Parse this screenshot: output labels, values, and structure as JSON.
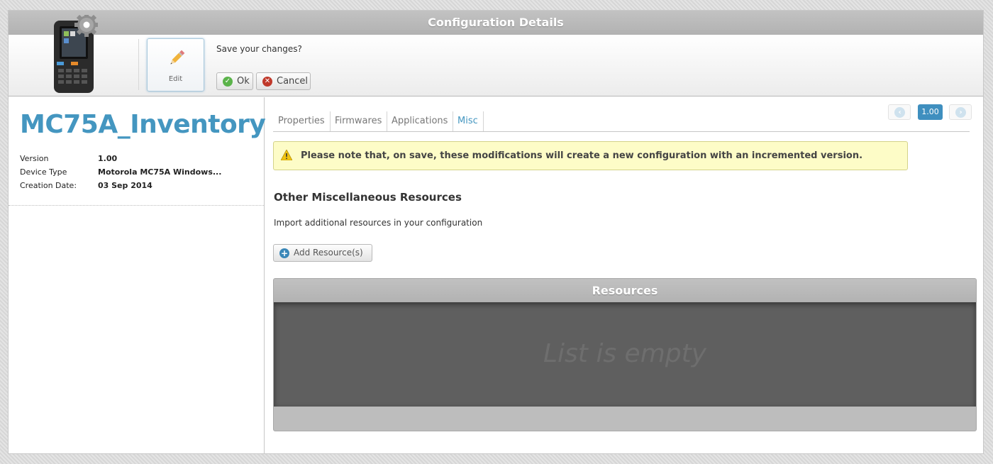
{
  "window": {
    "title": "Configuration Details"
  },
  "toolbar": {
    "edit_label": "Edit",
    "save_prompt": "Save your changes?",
    "ok_label": "Ok",
    "cancel_label": "Cancel"
  },
  "config": {
    "name": "MC75A_Inventory",
    "properties": [
      {
        "key": "Version",
        "value": "1.00"
      },
      {
        "key": "Device Type",
        "value": "Motorola MC75A Windows..."
      },
      {
        "key": "Creation Date:",
        "value": "03 Sep 2014"
      }
    ]
  },
  "tabs": [
    {
      "label": "Properties",
      "active": false
    },
    {
      "label": "Firmwares",
      "active": false
    },
    {
      "label": "Applications",
      "active": false
    },
    {
      "label": "Misc",
      "active": true
    }
  ],
  "version_nav": {
    "current": "1.00"
  },
  "notice": {
    "text": "Please note that, on save, these modifications will create a new configuration with an incremented version."
  },
  "misc": {
    "title": "Other Miscellaneous Resources",
    "description": "Import additional resources in your configuration",
    "add_label": "Add Resource(s)"
  },
  "resources": {
    "title": "Resources",
    "empty_text": "List is empty"
  },
  "colors": {
    "accent": "#4496c0",
    "notice_bg": "#fdfcc7",
    "titlebar": "#b8b8b8"
  }
}
